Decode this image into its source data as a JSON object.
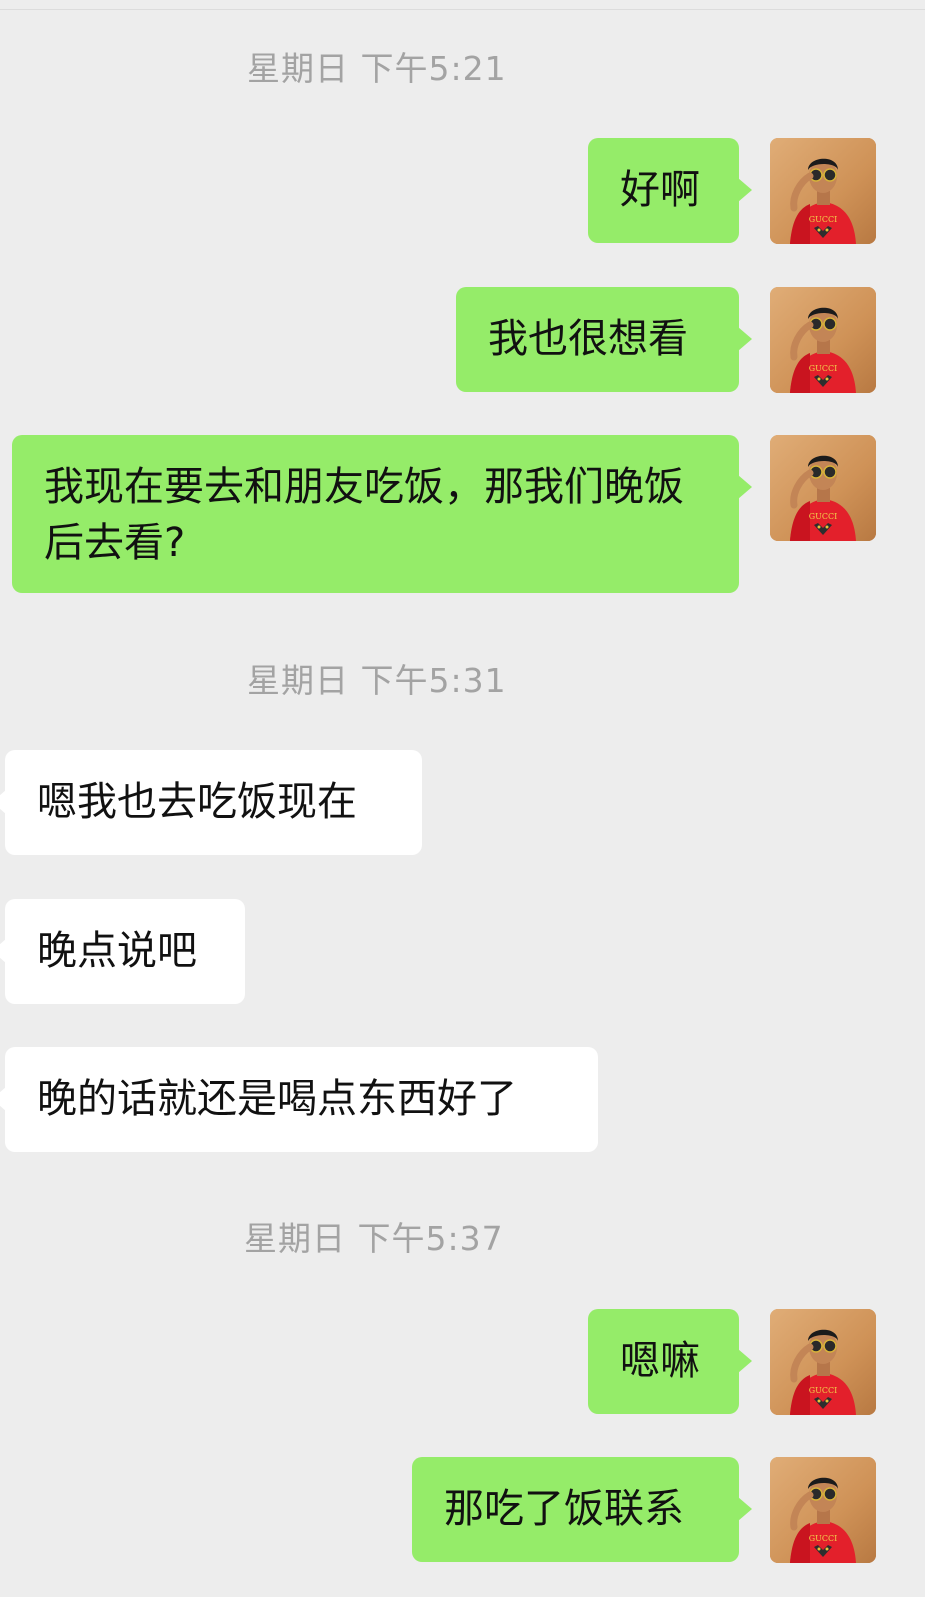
{
  "timestamps": [
    "星期日 下午5:21",
    "星期日 下午5:31",
    "星期日 下午5:37"
  ],
  "messages": [
    {
      "sender": "me",
      "text": "好啊"
    },
    {
      "sender": "me",
      "text": "我也很想看"
    },
    {
      "sender": "me",
      "text": "我现在要去和朋友吃饭，那我们晚饭后去看?"
    },
    {
      "sender": "other",
      "text": "嗯我也去吃饭现在"
    },
    {
      "sender": "other",
      "text": "晚点说吧"
    },
    {
      "sender": "other",
      "text": "晚的话就还是喝点东西好了"
    },
    {
      "sender": "me",
      "text": "嗯嘛"
    },
    {
      "sender": "me",
      "text": "那吃了饭联系"
    }
  ],
  "avatar": {
    "shirt_print": "GUCCI"
  },
  "colors": {
    "background": "#ededed",
    "my_bubble": "#95ec69",
    "their_bubble": "#ffffff",
    "timestamp_text": "#a3a3a3"
  }
}
